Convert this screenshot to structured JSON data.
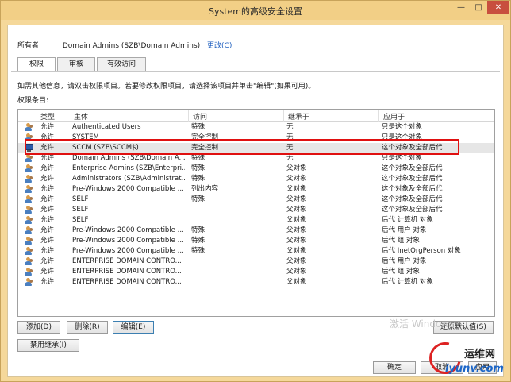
{
  "window": {
    "title": "System的高级安全设置",
    "controls": {
      "minimize": "—",
      "maximize": "□",
      "close": "✕"
    }
  },
  "owner": {
    "label": "所有者:",
    "value": "Domain Admins (SZB\\Domain Admins)",
    "change_link": "更改(C)"
  },
  "tabs": [
    {
      "label": "权限",
      "active": true
    },
    {
      "label": "审核",
      "active": false
    },
    {
      "label": "有效访问",
      "active": false
    }
  ],
  "info_text": "如需其他信息，请双击权限项目。若要修改权限项目，请选择该项目并单击\"编辑\"(如果可用)。",
  "entries_label": "权限条目:",
  "columns": [
    "类型",
    "主体",
    "访问",
    "继承于",
    "应用于"
  ],
  "rows": [
    {
      "icon": "users-icon",
      "type": "允许",
      "principal": "Authenticated Users",
      "access": "特殊",
      "inherited": "无",
      "applies": "只是这个对象"
    },
    {
      "icon": "users-icon",
      "type": "允许",
      "principal": "SYSTEM",
      "access": "完全控制",
      "inherited": "无",
      "applies": "只是这个对象"
    },
    {
      "icon": "computer-icon",
      "type": "允许",
      "principal": "SCCM (SZB\\SCCM$)",
      "access": "完全控制",
      "inherited": "无",
      "applies": "这个对象及全部后代",
      "selected": true
    },
    {
      "icon": "users-icon",
      "type": "允许",
      "principal": "Domain Admins (SZB\\Domain A...",
      "access": "特殊",
      "inherited": "无",
      "applies": "只是这个对象"
    },
    {
      "icon": "users-icon",
      "type": "允许",
      "principal": "Enterprise Admins (SZB\\Enterpri...",
      "access": "特殊",
      "inherited": "父对象",
      "applies": "这个对象及全部后代"
    },
    {
      "icon": "users-icon",
      "type": "允许",
      "principal": "Administrators (SZB\\Administrat...",
      "access": "特殊",
      "inherited": "父对象",
      "applies": "这个对象及全部后代"
    },
    {
      "icon": "users-icon",
      "type": "允许",
      "principal": "Pre-Windows 2000 Compatible ...",
      "access": "列出内容",
      "inherited": "父对象",
      "applies": "这个对象及全部后代"
    },
    {
      "icon": "users-icon",
      "type": "允许",
      "principal": "SELF",
      "access": "特殊",
      "inherited": "父对象",
      "applies": "这个对象及全部后代"
    },
    {
      "icon": "users-icon",
      "type": "允许",
      "principal": "SELF",
      "access": "",
      "inherited": "父对象",
      "applies": "这个对象及全部后代"
    },
    {
      "icon": "users-icon",
      "type": "允许",
      "principal": "SELF",
      "access": "",
      "inherited": "父对象",
      "applies": "后代 计算机 对象"
    },
    {
      "icon": "users-icon",
      "type": "允许",
      "principal": "Pre-Windows 2000 Compatible ...",
      "access": "特殊",
      "inherited": "父对象",
      "applies": "后代 用户 对象"
    },
    {
      "icon": "users-icon",
      "type": "允许",
      "principal": "Pre-Windows 2000 Compatible ...",
      "access": "特殊",
      "inherited": "父对象",
      "applies": "后代 组 对象"
    },
    {
      "icon": "users-icon",
      "type": "允许",
      "principal": "Pre-Windows 2000 Compatible ...",
      "access": "特殊",
      "inherited": "父对象",
      "applies": "后代 InetOrgPerson 对象"
    },
    {
      "icon": "users-icon",
      "type": "允许",
      "principal": "ENTERPRISE DOMAIN CONTRO...",
      "access": "",
      "inherited": "父对象",
      "applies": "后代 用户 对象"
    },
    {
      "icon": "users-icon",
      "type": "允许",
      "principal": "ENTERPRISE DOMAIN CONTRO...",
      "access": "",
      "inherited": "父对象",
      "applies": "后代 组 对象"
    },
    {
      "icon": "users-icon",
      "type": "允许",
      "principal": "ENTERPRISE DOMAIN CONTRO...",
      "access": "",
      "inherited": "父对象",
      "applies": "后代 计算机 对象"
    }
  ],
  "buttons": {
    "add": "添加(D)",
    "remove": "删除(R)",
    "edit": "编辑(E)",
    "restore_defaults": "还原默认值(S)",
    "disable_inheritance": "禁用继承(I)",
    "ok": "确定",
    "cancel": "取消",
    "apply": "应用"
  },
  "watermark": "激活 Windows",
  "logo": {
    "brand": "运维网",
    "url": "iyunv.com"
  },
  "colors": {
    "highlight_border": "#e01010",
    "titlebar": "#f2cf86",
    "selected_row": "#e6e6e6",
    "link": "#1f5fbf"
  }
}
